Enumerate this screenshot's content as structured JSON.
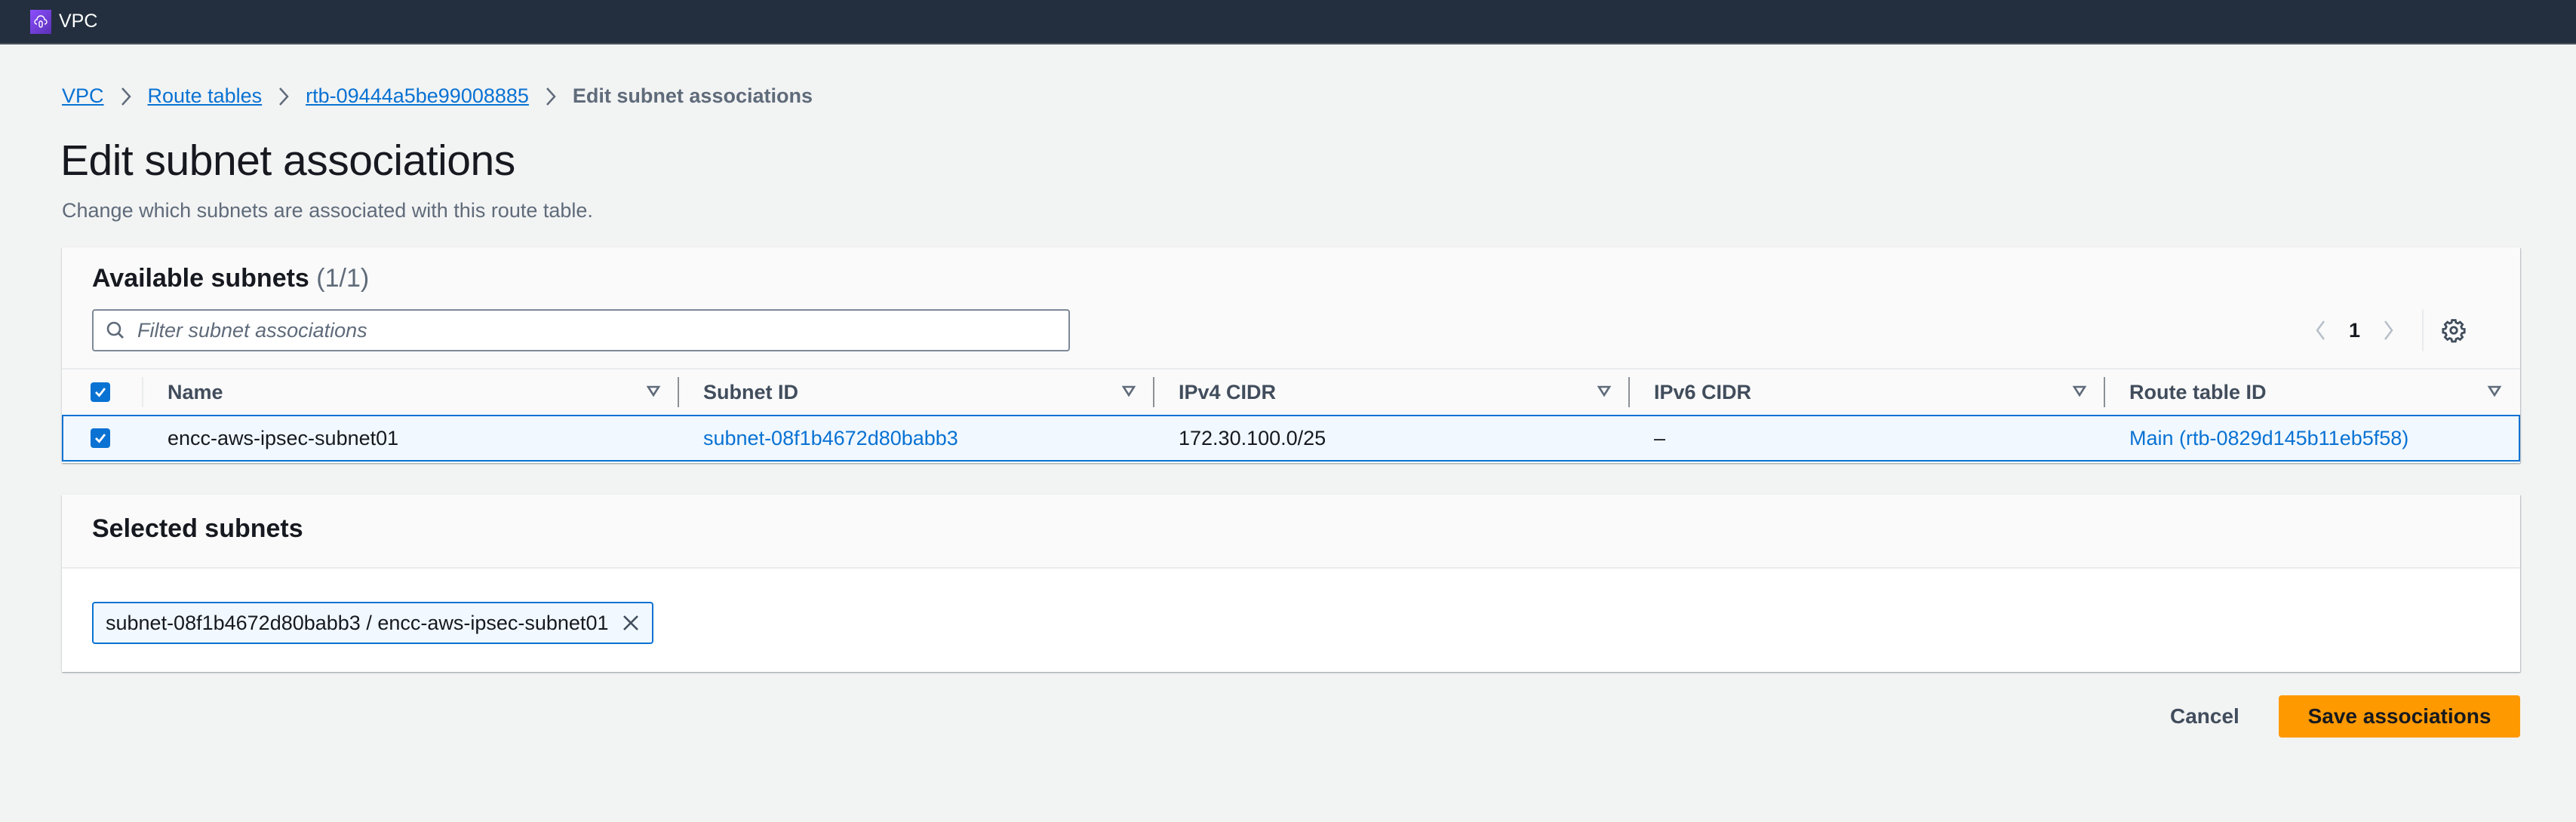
{
  "topbar": {
    "service_name": "VPC",
    "service_icon": "vpc-cloud-shield-icon"
  },
  "breadcrumb": [
    {
      "label": "VPC",
      "link": true
    },
    {
      "label": "Route tables",
      "link": true
    },
    {
      "label": "rtb-09444a5be99008885",
      "link": true
    },
    {
      "label": "Edit subnet associations",
      "link": false
    }
  ],
  "page": {
    "title": "Edit subnet associations",
    "description": "Change which subnets are associated with this route table."
  },
  "available": {
    "heading": "Available subnets",
    "count": "(1/1)",
    "filter_placeholder": "Filter subnet associations",
    "filter_value": "",
    "pagination": {
      "current_page": "1"
    },
    "select_all_checked": true,
    "columns": [
      "Name",
      "Subnet ID",
      "IPv4 CIDR",
      "IPv6 CIDR",
      "Route table ID"
    ],
    "rows": [
      {
        "checked": true,
        "name": "encc-aws-ipsec-subnet01",
        "subnet_id": "subnet-08f1b4672d80babb3",
        "ipv4_cidr": "172.30.100.0/25",
        "ipv6_cidr": "–",
        "route_table_id": "Main (rtb-0829d145b11eb5f58)"
      }
    ]
  },
  "selected": {
    "heading": "Selected subnets",
    "tokens": [
      {
        "label": "subnet-08f1b4672d80babb3 / encc-aws-ipsec-subnet01"
      }
    ]
  },
  "actions": {
    "cancel_label": "Cancel",
    "save_label": "Save associations"
  },
  "colors": {
    "topbar": "#232f3e",
    "link": "#0972d3",
    "primary_button": "#ff9900",
    "selected_row_bg": "#f1f8ff"
  }
}
